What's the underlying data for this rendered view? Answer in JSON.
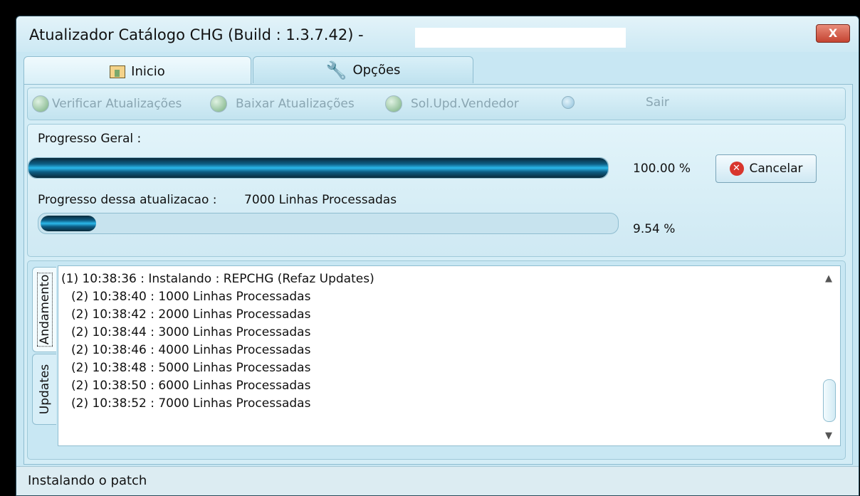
{
  "window": {
    "title": "Atualizador Catálogo CHG  (Build : 1.3.7.42) -",
    "close_label": "X"
  },
  "tabs": [
    {
      "label": "Inicio",
      "icon": "home-icon",
      "active": true
    },
    {
      "label": "Opções",
      "icon": "wrench-icon",
      "active": false
    }
  ],
  "toolbar": {
    "items": [
      {
        "label": "Verificar Atualizações",
        "icon": "globe-check-icon"
      },
      {
        "label": "Baixar Atualizações",
        "icon": "globe-download-icon"
      },
      {
        "label": "Sol.Upd.Vendedor",
        "icon": "globe-user-icon"
      },
      {
        "label": "Sair",
        "icon": "power-icon"
      }
    ]
  },
  "progress": {
    "general_label": "Progresso Geral :",
    "general_percent_text": "100.00 %",
    "general_fraction": 1.0,
    "update_label": "Progresso dessa atualizacao :",
    "update_lines_text": "7000 Linhas Processadas",
    "update_percent_text": "9.54 %",
    "update_fraction": 0.0954,
    "cancel_label": "Cancelar"
  },
  "side_tabs": [
    {
      "label": "Andamento",
      "active": true
    },
    {
      "label": "Updates",
      "active": false
    }
  ],
  "log": {
    "lines": [
      "(1) 10:38:36 : Instalando : REPCHG (Refaz Updates)",
      "(2) 10:38:40 : 1000 Linhas Processadas",
      "(2) 10:38:42 : 2000 Linhas Processadas",
      "(2) 10:38:44 : 3000 Linhas Processadas",
      "(2) 10:38:46 : 4000 Linhas Processadas",
      "(2) 10:38:48 : 5000 Linhas Processadas",
      "(2) 10:38:50 : 6000 Linhas Processadas",
      "(2) 10:38:52 : 7000 Linhas Processadas"
    ]
  },
  "status": {
    "text": "Instalando o patch"
  }
}
